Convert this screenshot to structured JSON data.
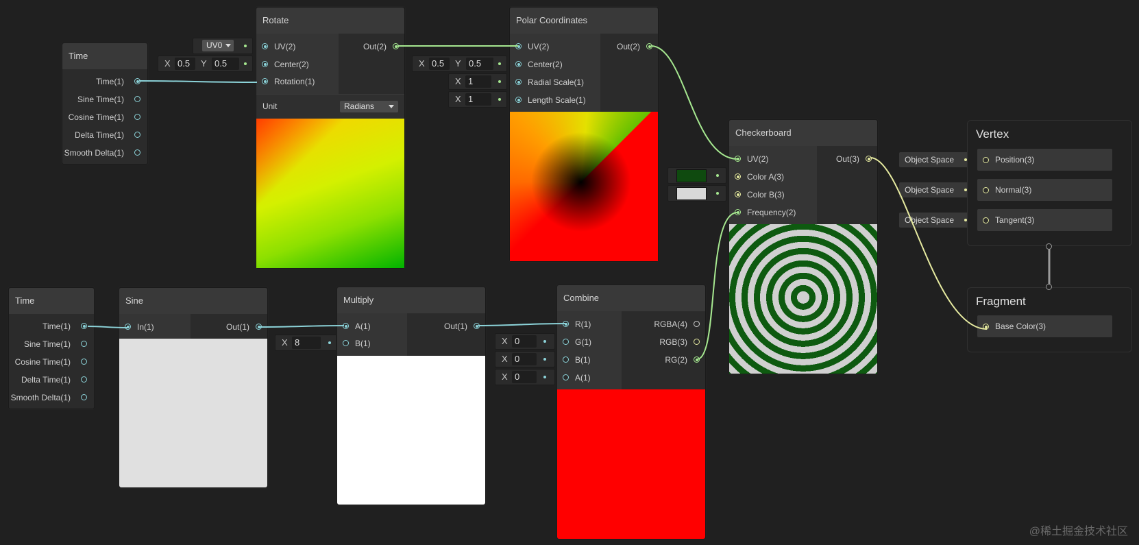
{
  "nodes": {
    "time_top": {
      "title": "Time",
      "outputs": [
        "Time(1)",
        "Sine Time(1)",
        "Cosine Time(1)",
        "Delta Time(1)",
        "Smooth Delta(1)"
      ]
    },
    "rotate": {
      "title": "Rotate",
      "inputs": [
        "UV(2)",
        "Center(2)",
        "Rotation(1)"
      ],
      "output": "Out(2)",
      "unit_label": "Unit",
      "unit_value": "Radians"
    },
    "polar": {
      "title": "Polar Coordinates",
      "inputs": [
        "UV(2)",
        "Center(2)",
        "Radial Scale(1)",
        "Length Scale(1)"
      ],
      "output": "Out(2)"
    },
    "checker": {
      "title": "Checkerboard",
      "inputs": [
        "UV(2)",
        "Color A(3)",
        "Color B(3)",
        "Frequency(2)"
      ],
      "output": "Out(3)",
      "color_a": "#0f4a0f",
      "color_b": "#d8d8d8"
    },
    "time_bottom": {
      "title": "Time",
      "outputs": [
        "Time(1)",
        "Sine Time(1)",
        "Cosine Time(1)",
        "Delta Time(1)",
        "Smooth Delta(1)"
      ]
    },
    "sine": {
      "title": "Sine",
      "input": "In(1)",
      "output": "Out(1)"
    },
    "multiply": {
      "title": "Multiply",
      "inputs": [
        "A(1)",
        "B(1)"
      ],
      "output": "Out(1)"
    },
    "combine": {
      "title": "Combine",
      "inputs": [
        "R(1)",
        "G(1)",
        "B(1)",
        "A(1)"
      ],
      "outputs": [
        "RGBA(4)",
        "RGB(3)",
        "RG(2)"
      ]
    }
  },
  "fields": {
    "uv_channel": "UV0",
    "rotate_center": {
      "x_label": "X",
      "x": "0.5",
      "y_label": "Y",
      "y": "0.5"
    },
    "polar_center": {
      "x_label": "X",
      "x": "0.5",
      "y_label": "Y",
      "y": "0.5"
    },
    "radial_scale": {
      "label": "X",
      "value": "1"
    },
    "length_scale": {
      "label": "X",
      "value": "1"
    },
    "multiply_b": {
      "label": "X",
      "value": "8"
    },
    "combine_g": {
      "label": "X",
      "value": "0"
    },
    "combine_b": {
      "label": "X",
      "value": "0"
    },
    "combine_a": {
      "label": "X",
      "value": "0"
    }
  },
  "master": {
    "vertex": {
      "title": "Vertex",
      "slots": [
        "Position(3)",
        "Normal(3)",
        "Tangent(3)"
      ],
      "space_labels": [
        "Object Space",
        "Object Space",
        "Object Space"
      ]
    },
    "fragment": {
      "title": "Fragment",
      "slots": [
        "Base Color(3)"
      ]
    }
  },
  "colors": {
    "wire_float": "#8cd3d9",
    "wire_vec2": "#a6e890",
    "wire_vec3": "#e6eaa0",
    "combine_preview": "#ff0000",
    "sine_preview": "#e0e0e0",
    "multiply_preview": "#ffffff"
  },
  "watermark": "@稀土掘金技术社区"
}
